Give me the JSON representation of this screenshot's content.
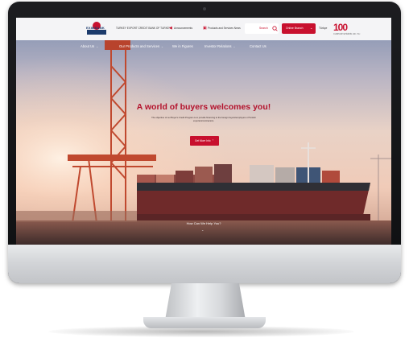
{
  "header": {
    "logo_text": "EXIMBANK",
    "tagline": "TURKEY EXPORT CREDIT BANK OF TURKEY",
    "announcements": "Announcements",
    "products": "Products and Services News",
    "search_label": "Search",
    "online_button": "Online Branch",
    "language": "Türkçe",
    "badge": "100",
    "badge_sub": "CUMHURİYETİMİZİN 100. YILI"
  },
  "nav": {
    "items": [
      {
        "label": "About Us"
      },
      {
        "label": "Our Products and Services"
      },
      {
        "label": "We in Figures"
      },
      {
        "label": "Investor Relations"
      },
      {
        "label": "Contact Us"
      }
    ]
  },
  "hero": {
    "title": "A world of buyers welcomes you!",
    "description": "The objective of our Buyer's Credit Program is to provide financing to the foreign buyers/employers of Turkish exporters/contractors.",
    "button": "Get More Info",
    "help": "How Can We Help You?"
  },
  "colors": {
    "brand_red": "#c8102e",
    "title_red": "#b3122d",
    "header_bg": "#f4f4f6"
  },
  "icons": [
    "megaphone-icon",
    "box-icon",
    "search-icon",
    "chevron-right-icon",
    "chevron-down-icon"
  ]
}
